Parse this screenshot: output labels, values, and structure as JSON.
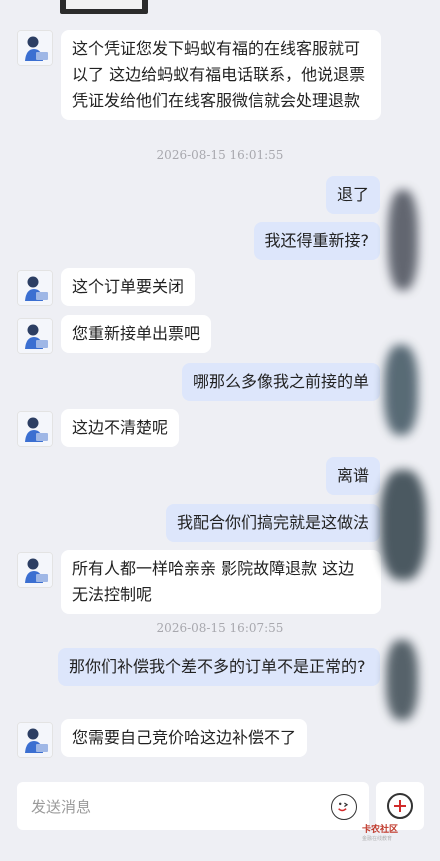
{
  "messages": [
    {
      "side": "left",
      "text": "这个凭证您发下蚂蚁有福的在线客服就可以了 这边给蚂蚁有福电话联系，他说退票凭证发给他们在线客服微信就会处理退款"
    },
    {
      "type": "timestamp",
      "text": "2026-08-15 16:01:55"
    },
    {
      "side": "right",
      "text": "退了"
    },
    {
      "side": "right",
      "text": "我还得重新接?"
    },
    {
      "side": "left",
      "text": "这个订单要关闭"
    },
    {
      "side": "left",
      "text": "您重新接单出票吧"
    },
    {
      "side": "right",
      "text": "哪那么多像我之前接的单"
    },
    {
      "side": "left",
      "text": "这边不清楚呢"
    },
    {
      "side": "right",
      "text": "离谱"
    },
    {
      "side": "right",
      "text": "我配合你们搞完就是这做法"
    },
    {
      "side": "left",
      "text": "所有人都一样哈亲亲 影院故障退款 这边无法控制呢"
    },
    {
      "type": "timestamp",
      "text": "2026-08-15 16:07:55"
    },
    {
      "side": "right",
      "text": "那你们补偿我个差不多的订单不是正常的?"
    },
    {
      "side": "left",
      "text": "您需要自己竞价哈这边补偿不了"
    }
  ],
  "input": {
    "placeholder": "发送消息"
  },
  "icons": {
    "emoji": "emoji-icon",
    "add": "plus-circle-icon"
  },
  "watermark": {
    "brand": "卡农社区",
    "sub": "金融在线教育"
  },
  "colors": {
    "background": "#eeeff4",
    "outgoing_bubble": "#dde6fb",
    "incoming_bubble": "#ffffff"
  }
}
